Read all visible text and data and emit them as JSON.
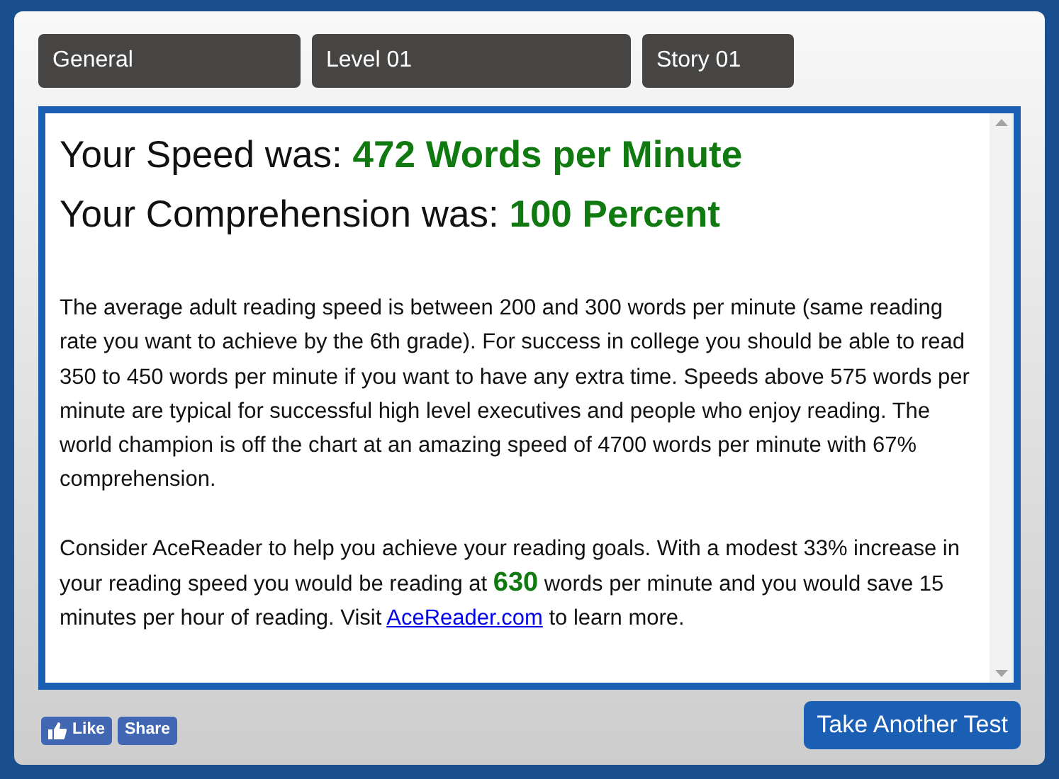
{
  "tabs": [
    {
      "label": "General"
    },
    {
      "label": "Level 01"
    },
    {
      "label": "Story 01"
    }
  ],
  "results": [
    {
      "label": "Your Speed was: ",
      "value": "472 Words per Minute"
    },
    {
      "label": "Your Comprehension was: ",
      "value": "100 Percent"
    }
  ],
  "paragraphs": [
    [
      {
        "kind": "text",
        "text": "The average adult reading speed is between 200 and 300 words per minute (same reading rate you want to achieve by the 6th grade). For success in college you should be able to read 350 to 450 words per minute if you want to have any extra time. Speeds above 575 words per minute are typical for successful high level executives and people who enjoy reading. The world champion is off the chart at an amazing speed of 4700 words per minute with 67% comprehension."
      }
    ],
    [
      {
        "kind": "text",
        "text": "Consider AceReader to help you achieve your reading goals. With a modest 33% increase in your reading speed you would be reading at "
      },
      {
        "kind": "highlight",
        "text": "630"
      },
      {
        "kind": "text",
        "text": " words per minute and you would save 15 minutes per hour of reading. Visit "
      },
      {
        "kind": "link",
        "text": "AceReader.com"
      },
      {
        "kind": "text",
        "text": " to learn more."
      }
    ]
  ],
  "social": {
    "like": "Like",
    "share": "Share"
  },
  "button": "Take Another Test"
}
